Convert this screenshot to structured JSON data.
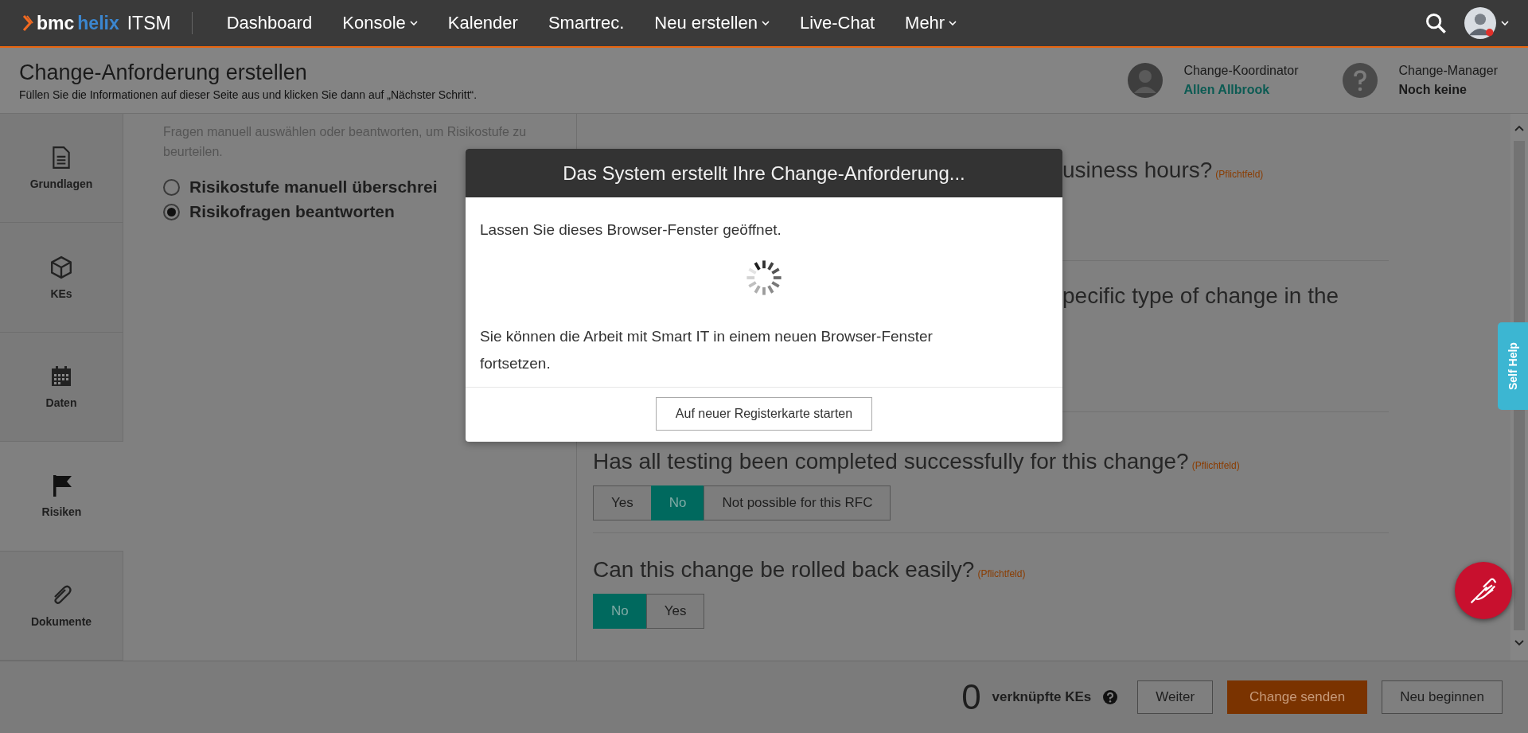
{
  "nav": {
    "brand": "bmc",
    "product": "helix",
    "app": "ITSM",
    "items": [
      {
        "label": "Dashboard",
        "has_menu": false
      },
      {
        "label": "Konsole",
        "has_menu": true
      },
      {
        "label": "Kalender",
        "has_menu": false
      },
      {
        "label": "Smartrec.",
        "has_menu": false
      },
      {
        "label": "Neu erstellen",
        "has_menu": true
      },
      {
        "label": "Live-Chat",
        "has_menu": false
      },
      {
        "label": "Mehr",
        "has_menu": true
      }
    ]
  },
  "header": {
    "title": "Change-Anforderung erstellen",
    "subtitle": "Füllen Sie die Informationen auf dieser Seite aus und klicken Sie dann auf „Nächster Schritt“.",
    "roles": [
      {
        "label": "Change-Koordinator",
        "value": "Allen Allbrook",
        "assigned": true
      },
      {
        "label": "Change-Manager",
        "value": "Noch keine",
        "assigned": false
      }
    ]
  },
  "sidebar": {
    "items": [
      {
        "label": "Grundlagen",
        "kind": "document",
        "selected": false
      },
      {
        "label": "KEs",
        "kind": "cube",
        "selected": false
      },
      {
        "label": "Daten",
        "kind": "calendar",
        "selected": false
      },
      {
        "label": "Risiken",
        "kind": "flag",
        "selected": true
      },
      {
        "label": "Dokumente",
        "kind": "paperclip",
        "selected": false
      }
    ]
  },
  "risk": {
    "hint": "Fragen manuell auswählen oder beantworten, um Risikostufe zu beurteilen.",
    "options": [
      {
        "label": "Risikostufe manuell überschrei",
        "selected": false
      },
      {
        "label": "Risikofragen beantworten",
        "selected": true
      }
    ]
  },
  "questions": [
    {
      "text": "usiness hours?",
      "required_mark": "(Pflichtfeld)",
      "partly_covered": true
    },
    {
      "text": "pecific type of change in the",
      "partly_covered": true
    },
    {
      "text": "Has all testing been completed successfully for this change?",
      "required_mark": "(Pflichtfeld)",
      "partly_covered": false,
      "answers": [
        {
          "label": "Yes",
          "selected": false
        },
        {
          "label": "No",
          "selected": true
        },
        {
          "label": "Not possible for this RFC",
          "selected": false
        }
      ]
    },
    {
      "text": "Can this change be rolled back easily?",
      "required_mark": "(Pflichtfeld)",
      "partly_covered": false,
      "answers": [
        {
          "label": "No",
          "selected": true
        },
        {
          "label": "Yes",
          "selected": false
        }
      ]
    }
  ],
  "footer": {
    "count": "0",
    "count_label": "verknüpfte KEs",
    "buttons": [
      {
        "label": "Weiter",
        "kind": "secondary"
      },
      {
        "label": "Change senden",
        "kind": "primary"
      },
      {
        "label": "Neu beginnen",
        "kind": "secondary"
      }
    ]
  },
  "self_help": {
    "label": "Self Help"
  },
  "dialog": {
    "title": "Das System erstellt Ihre Change-Anforderung...",
    "message": "Lassen Sie dieses Browser-Fenster geöffnet.",
    "note": "Sie können die Arbeit mit Smart IT in einem neuen Browser-Fenster fortsetzen.",
    "button": "Auf neuer Registerkarte starten"
  }
}
